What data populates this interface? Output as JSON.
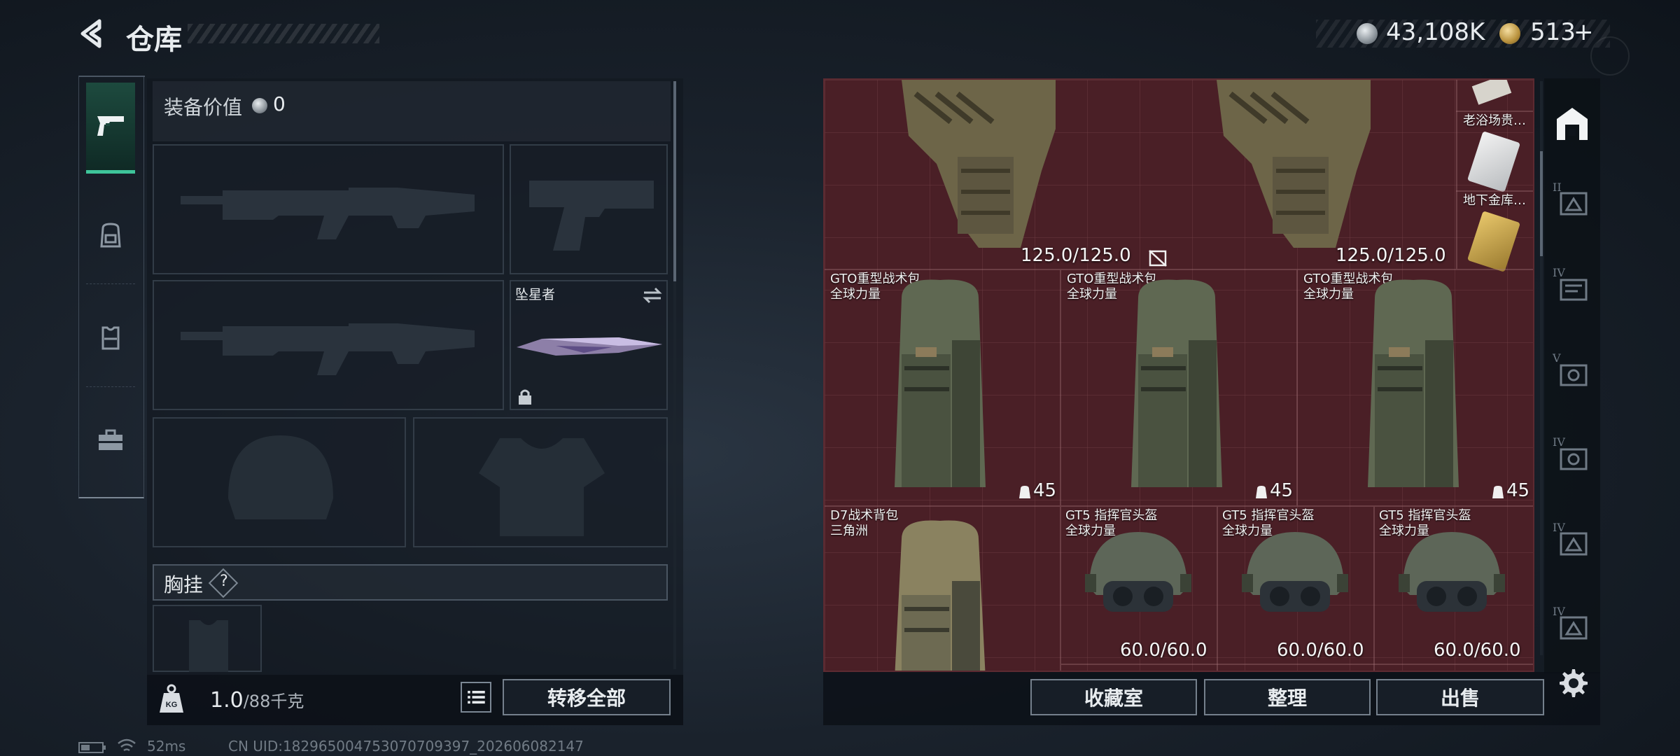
{
  "header": {
    "title": "仓库",
    "currency_silver": "43,108K",
    "currency_gold": "513",
    "currency_gold_add": "+"
  },
  "loadout": {
    "value_label": "装备价值",
    "value": "0",
    "melee_name": "坠星者",
    "chest_label": "胸挂",
    "chest_help": "?",
    "weight_current": "1.0",
    "weight_max": "/88千克",
    "transfer_all_label": "转移全部"
  },
  "inventory": {
    "vest_durability_1": "125.0/125.0",
    "vest_durability_2": "125.0/125.0",
    "card_1_name": "老浴场贵…",
    "card_2_name": "地下金库…",
    "backpack_name": "GTO重型战术包",
    "backpack_sub": "全球力量",
    "backpack_capacity": "45",
    "d7_name": "D7战术背包",
    "d7_sub": "三角洲",
    "helmet_name": "GT5 指挥官头盔",
    "helmet_sub": "全球力量",
    "helmet_durability": "60.0/60.0"
  },
  "actions": {
    "collection_label": "收藏室",
    "sort_label": "整理",
    "sell_label": "出售"
  },
  "categories": [
    "II",
    "IV",
    "V",
    "IV",
    "IV",
    "IV"
  ],
  "status": {
    "ping": "52ms",
    "uid": "CN UID:182965004753070709397_202606082147"
  },
  "colors": {
    "accent_green": "#3ec49a",
    "inventory_bg": "#4a1f26"
  }
}
